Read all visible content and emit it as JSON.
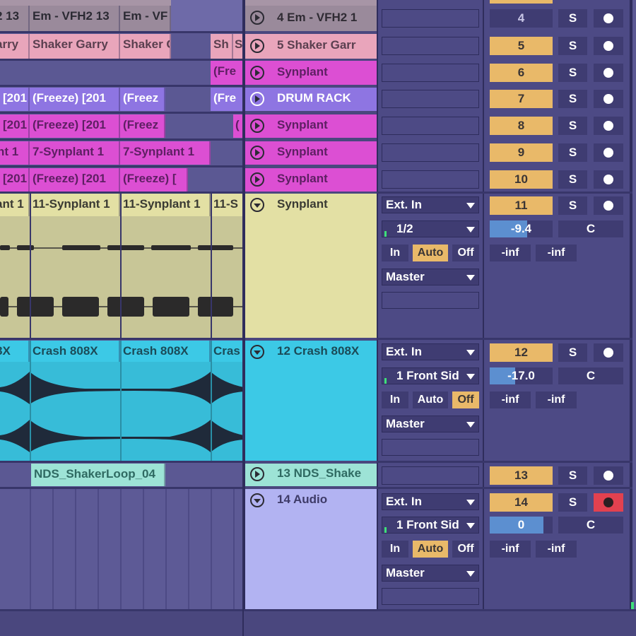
{
  "arrangement": {
    "row1": {
      "clips": [
        "2 13",
        "Em - VFH2 13",
        "Em - VF"
      ]
    },
    "row2": {
      "clips": [
        "arry",
        "Shaker Garry",
        "Shaker G",
        "Sh",
        "S"
      ]
    },
    "row3": {
      "clips": [
        "(Fre"
      ]
    },
    "row4": {
      "clips": [
        "[201",
        "(Freeze) [201",
        "(Freez",
        "(Fre"
      ]
    },
    "row5": {
      "clips": [
        "[201",
        "(Freeze) [201",
        "(Freez",
        "("
      ]
    },
    "row6": {
      "clips": [
        "nt 1",
        "7-Synplant 1",
        "7-Synplant 1"
      ]
    },
    "row7": {
      "clips": [
        "[201",
        "(Freeze) [201",
        "(Freeze) ["
      ]
    },
    "synplant_lane": {
      "clips": [
        "ant 1",
        "11-Synplant 1",
        "11-Synplant 1",
        "11-S"
      ]
    },
    "crash_lane": {
      "clips": [
        "8X",
        "Crash 808X",
        "Crash 808X",
        "Cras"
      ]
    },
    "shaker_lane": {
      "clips": [
        "NDS_ShakerLoop_04"
      ]
    }
  },
  "tracks": [
    {
      "name": "4 Em - VFH2 1",
      "number": "4",
      "solo": "S"
    },
    {
      "name": "5 Shaker Garr",
      "number": "5",
      "solo": "S"
    },
    {
      "name": "Synplant",
      "number": "6",
      "solo": "S"
    },
    {
      "name": "DRUM RACK",
      "number": "7",
      "solo": "S"
    },
    {
      "name": "Synplant",
      "number": "8",
      "solo": "S"
    },
    {
      "name": "Synplant",
      "number": "9",
      "solo": "S"
    },
    {
      "name": "Synplant",
      "number": "10",
      "solo": "S"
    },
    {
      "name": "Synplant",
      "number": "11",
      "solo": "S",
      "input_type": "Ext. In",
      "input_channel": "1/2",
      "monitor": [
        "In",
        "Auto",
        "Off"
      ],
      "monitor_active": "Auto",
      "output": "Master",
      "volume": "-9.4",
      "volume_level": 0.6,
      "pan": "C",
      "sends": [
        "-inf",
        "-inf"
      ],
      "armed": false
    },
    {
      "name": "12 Crash 808X",
      "number": "12",
      "solo": "S",
      "input_type": "Ext. In",
      "input_channel": "1 Front Sid",
      "monitor": [
        "In",
        "Auto",
        "Off"
      ],
      "monitor_active": "Off",
      "output": "Master",
      "volume": "-17.0",
      "volume_level": 0.4,
      "pan": "C",
      "sends": [
        "-inf",
        "-inf"
      ],
      "armed": false
    },
    {
      "name": "13 NDS_Shake",
      "number": "13",
      "solo": "S"
    },
    {
      "name": "14 Audio",
      "number": "14",
      "solo": "S",
      "input_type": "Ext. In",
      "input_channel": "1 Front Sid",
      "monitor": [
        "In",
        "Auto",
        "Off"
      ],
      "monitor_active": "Auto",
      "output": "Master",
      "volume": "0",
      "volume_level": 0.85,
      "pan": "C",
      "sends": [
        "-inf",
        "-inf"
      ],
      "armed": true
    }
  ],
  "icons": {
    "clip_launch": "play-circle-icon",
    "fold": "fold-arrow-icon",
    "dropdown": "chevron-down-icon",
    "arm": "record-arm-icon"
  },
  "colors": {
    "background": "#4a477e",
    "pink": "#e9a5bb",
    "magenta": "#dc4fd3",
    "drum_rack": "#8e75e2",
    "khaki": "#e3e0a4",
    "cyan": "#3cc9e6",
    "mint": "#9de3d6",
    "lavender": "#b2b3f2",
    "accent_orange": "#e9b969",
    "arm_red": "#e2414f"
  }
}
